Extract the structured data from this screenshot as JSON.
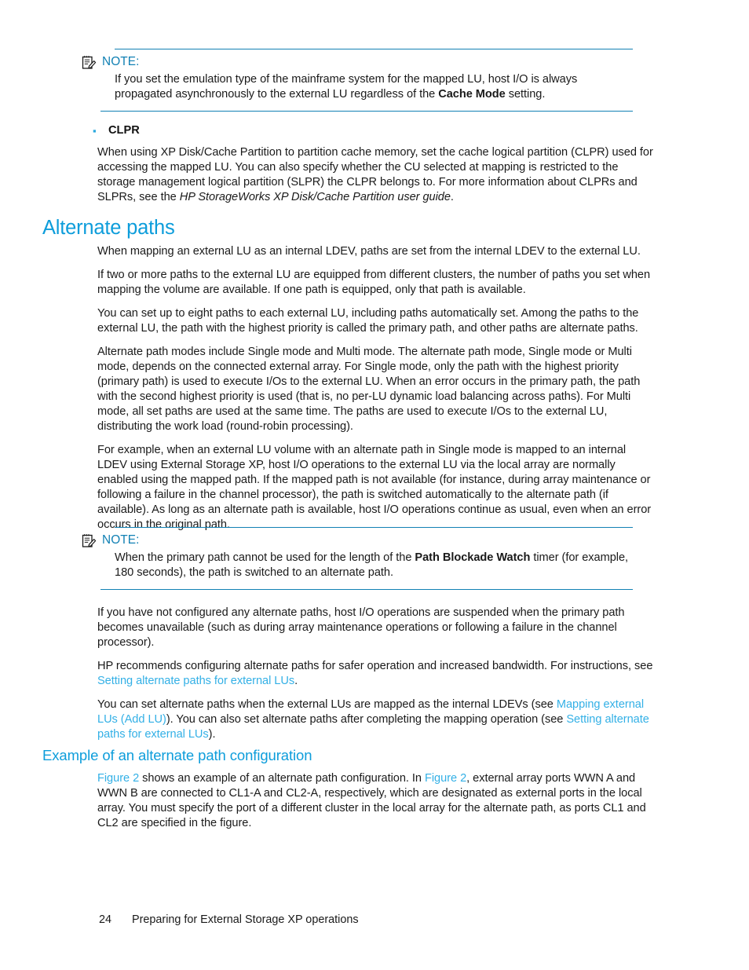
{
  "document": {
    "note_label": "NOTE:",
    "note_icon": "note-memo-icon"
  },
  "note_top": {
    "label": "NOTE:",
    "text_part1": "If you set the emulation type of the mainframe system for the mapped LU, host I/O is always propagated asynchronously to the external LU regardless of the ",
    "bold_term": "Cache Mode",
    "text_part2": " setting."
  },
  "clpr_bullet": {
    "label": "CLPR",
    "text_part1": "When using XP Disk/Cache Partition to partition cache memory, set the cache logical partition (CLPR) used for accessing the mapped LU. You can also specify whether the CU selected at mapping is restricted to the storage management logical partition (SLPR) the CLPR belongs to. For more information about CLPRs and SLPRs, see the ",
    "italic_title": "HP StorageWorks XP Disk/Cache Partition user guide",
    "text_part2": "."
  },
  "section_alternate_paths": {
    "heading": "Alternate paths",
    "p1": "When mapping an external LU as an internal LDEV, paths are set from the internal LDEV to the external LU.",
    "p2": "If two or more paths to the external LU are equipped from different clusters, the number of paths you set when mapping the volume are available. If one path is equipped, only that path is available.",
    "p3": "You can set up to eight paths to each external LU, including paths automatically set. Among the paths to the external LU, the path with the highest priority is called the primary path, and other paths are alternate paths.",
    "p4": "Alternate path modes include Single mode and Multi mode. The alternate path mode, Single mode or Multi mode, depends on the connected external array. For Single mode, only the path with the highest priority (primary path) is used to execute I/Os to the external LU. When an error occurs in the primary path, the path with the second highest priority is used (that is, no per-LU dynamic load balancing across paths). For Multi mode, all set paths are used at the same time. The paths are used to execute I/Os to the external LU, distributing the work load (round-robin processing).",
    "p5": "For example, when an external LU volume with an alternate path in Single mode is mapped to an internal LDEV using External Storage XP, host I/O operations to the external LU via the local array are normally enabled using the mapped path. If the mapped path is not available (for instance, during array maintenance or following a failure in the channel processor), the path is switched automatically to the alternate path (if available). As long as an alternate path is available, host I/O operations continue as usual, even when an error occurs in the original path."
  },
  "note_bottom": {
    "label": "NOTE:",
    "text_part1": "When the primary path cannot be used for the length of the ",
    "bold_term": "Path Blockade Watch",
    "text_part2": " timer (for example, 180 seconds), the path is switched to an alternate path."
  },
  "section_after_note": {
    "p1": "If you have not configured any alternate paths, host I/O operations are suspended when the primary path becomes unavailable (such as during array maintenance operations or following a failure in the channel processor).",
    "p2_part1": "HP recommends configuring alternate paths for safer operation and increased bandwidth. For instructions, see ",
    "p2_link": "Setting alternate paths for external LUs",
    "p2_part2": ".",
    "p3_part1": "You can set alternate paths when the external LUs are mapped as the internal LDEVs (see ",
    "p3_link1": "Mapping external LUs (Add LU)",
    "p3_part2": "). You can also set alternate paths after completing the mapping operation (see ",
    "p3_link2": "Setting alternate paths for external LUs",
    "p3_part3": ")."
  },
  "section_example": {
    "heading": "Example of an alternate path configuration",
    "p1_link1": "Figure 2",
    "p1_part1": " shows an example of an alternate path configuration. In ",
    "p1_link2": "Figure 2",
    "p1_part2": ", external array ports WWN A and WWN B are connected to CL1-A and CL2-A, respectively, which are designated as external ports in the local array. You must specify the port of a different cluster in the local array for the alternate path, as ports CL1 and CL2 are specified in the figure."
  },
  "footer": {
    "page_number": "24",
    "chapter_title": "Preparing for External Storage XP operations"
  },
  "colors": {
    "heading_blue": "#0d9ddb",
    "rule_blue": "#1281b4",
    "link_blue": "#33b0e6",
    "bullet_blue": "#29a8dd",
    "text_black": "#1a1a1a"
  }
}
